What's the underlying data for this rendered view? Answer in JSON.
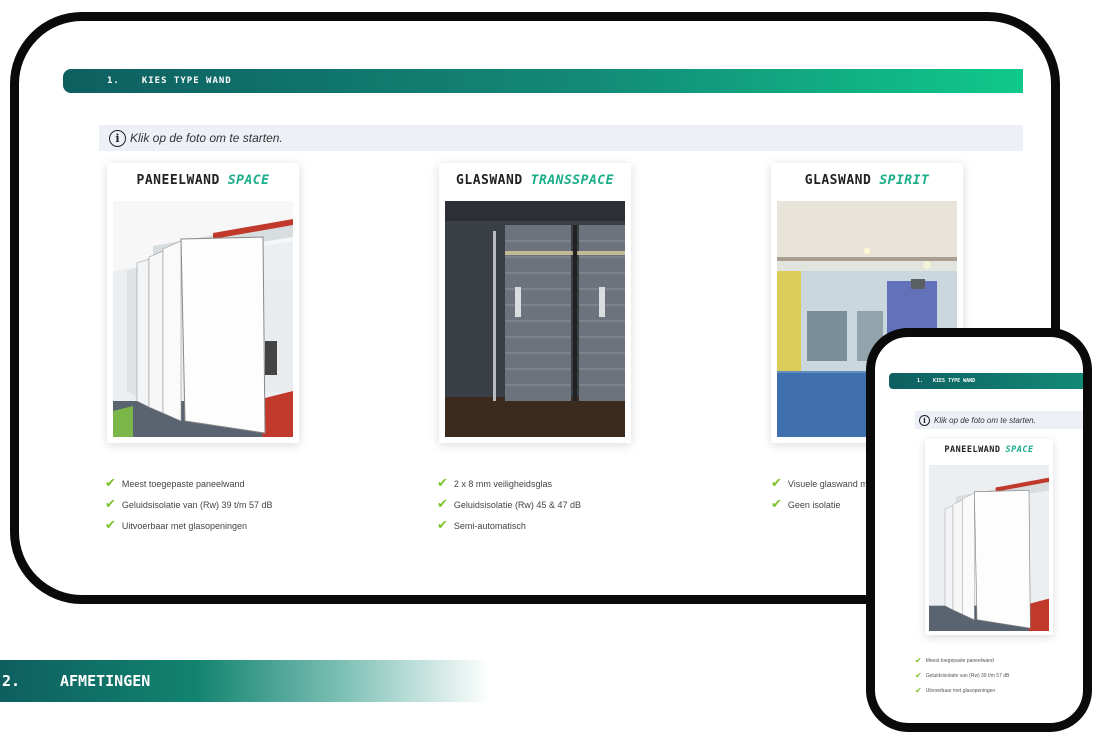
{
  "desktop": {
    "step": {
      "number": "1.",
      "label": "KIES TYPE WAND"
    },
    "hint": {
      "icon": "info-icon",
      "text": "Klik op de foto om te starten."
    },
    "cards": [
      {
        "title": "PANEELWAND",
        "accent": "SPACE",
        "features": [
          "Meest toegepaste paneelwand",
          "Geluidsisolatie van (Rw) 39 t/m 57 dB",
          "Uitvoerbaar met glasopeningen"
        ]
      },
      {
        "title": "GLASWAND",
        "accent": "TRANSSPACE",
        "features": [
          "2 x 8 mm veiligheidsglas",
          "Geluidsisolatie (Rw) 45 & 47 dB",
          "Semi-automatisch"
        ]
      },
      {
        "title": "GLASWAND",
        "accent": "SPIRIT",
        "features": [
          "Visuele glaswand m",
          "Geen isolatie"
        ]
      }
    ]
  },
  "section2": {
    "number": "2.",
    "label": "AFMETINGEN"
  },
  "mobile": {
    "step": {
      "number": "1.",
      "label": "KIES TYPE WAND"
    },
    "hint": {
      "text": "Klik op de foto om te starten."
    },
    "card": {
      "title": "PANEELWAND",
      "accent": "SPACE"
    },
    "features": [
      "Meest toegepaste paneelwand",
      "Geluidsisolatie van (Rw) 39 t/m 57 dB",
      "Uitvoerbaar met glasopeningen"
    ]
  },
  "colors": {
    "accent": "#1aae8a",
    "check": "#7cc22a",
    "bar_dark": "#0e5f60",
    "bar_light": "#10c98a"
  },
  "icons": {
    "check": "check-icon",
    "info": "info-icon"
  }
}
